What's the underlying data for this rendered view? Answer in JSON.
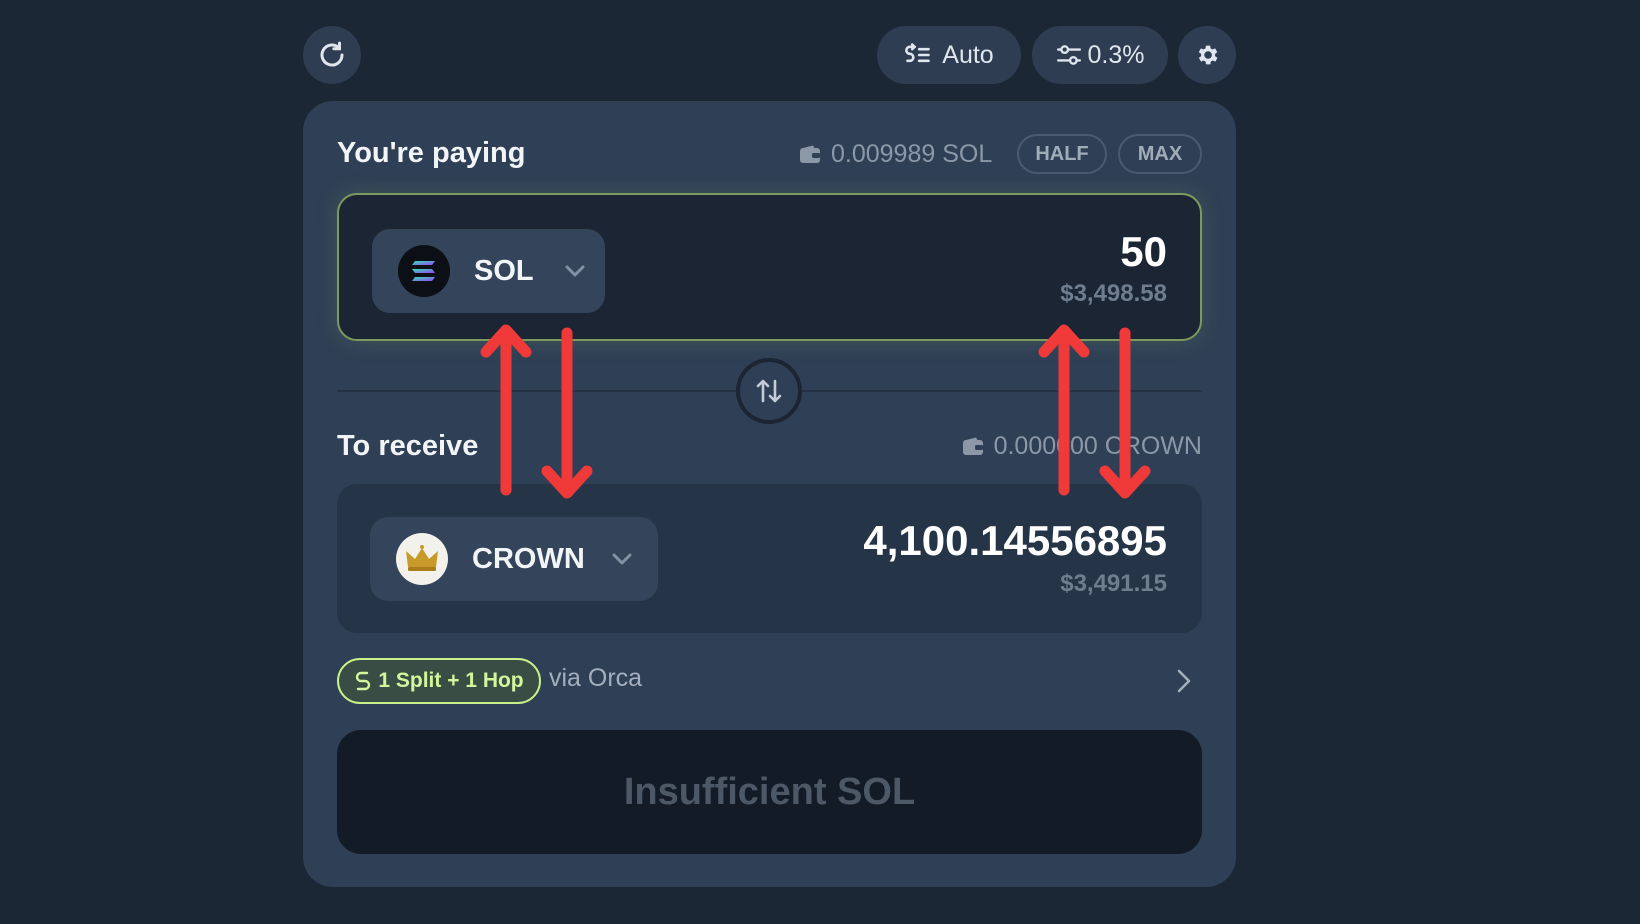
{
  "toolbar": {
    "refresh_icon": "refresh-icon",
    "auto_label": "Auto",
    "slippage_label": "0.3%",
    "settings_icon": "gear-icon"
  },
  "pay": {
    "heading": "You're paying",
    "balance": "0.009989 SOL",
    "half_label": "HALF",
    "max_label": "MAX",
    "token": "SOL",
    "amount": "50",
    "usd": "$3,498.58"
  },
  "receive": {
    "heading": "To receive",
    "balance": "0.000000 CROWN",
    "token": "CROWN",
    "amount": "4,100.14556895",
    "usd": "$3,491.15"
  },
  "route": {
    "badge": "1 Split + 1 Hop",
    "via": "via Orca"
  },
  "submit_label": "Insufficient SOL",
  "colors": {
    "background": "#1c2736",
    "card": "#2f3f55",
    "accent_green": "#c9f08a",
    "annotation_red": "#f03a3a"
  }
}
